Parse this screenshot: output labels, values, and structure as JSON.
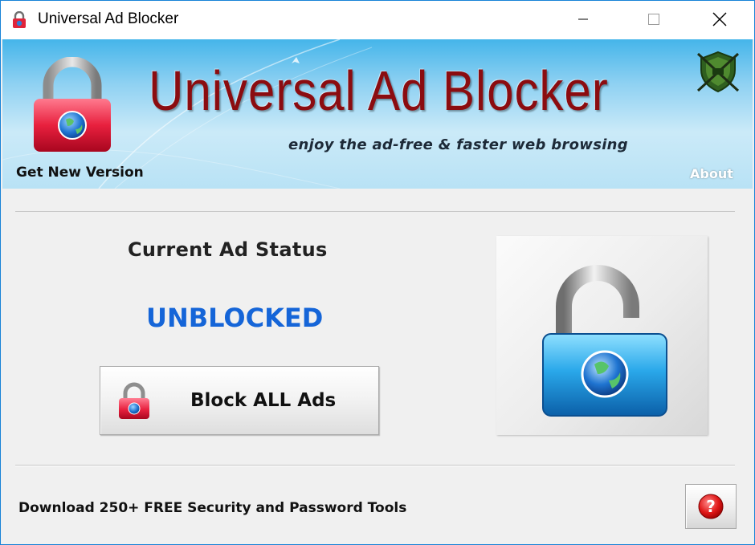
{
  "window": {
    "title": "Universal Ad Blocker",
    "controls": {
      "minimize_icon": "minimize-icon",
      "maximize_icon": "maximize-icon",
      "close_icon": "close-icon"
    }
  },
  "banner": {
    "title": "Universal Ad Blocker",
    "tagline": "enjoy the ad-free & faster web browsing",
    "get_new_version": "Get New Version",
    "about": "About",
    "lock_icon": "red-padlock-globe-icon",
    "logo_icon": "shield-swords-logo-icon"
  },
  "status": {
    "heading": "Current Ad Status",
    "value": "UNBLOCKED",
    "image_icon": "unlocked-blue-padlock-icon"
  },
  "actions": {
    "block_button": "Block ALL Ads",
    "block_button_icon": "red-padlock-icon"
  },
  "footer": {
    "link": "Download 250+ FREE Security and Password Tools",
    "help_icon": "help-icon"
  },
  "colors": {
    "accent_blue": "#1565d8",
    "title_red": "#8b0c10",
    "window_border": "#1883d7",
    "banner_sky": "#45b5ea"
  }
}
